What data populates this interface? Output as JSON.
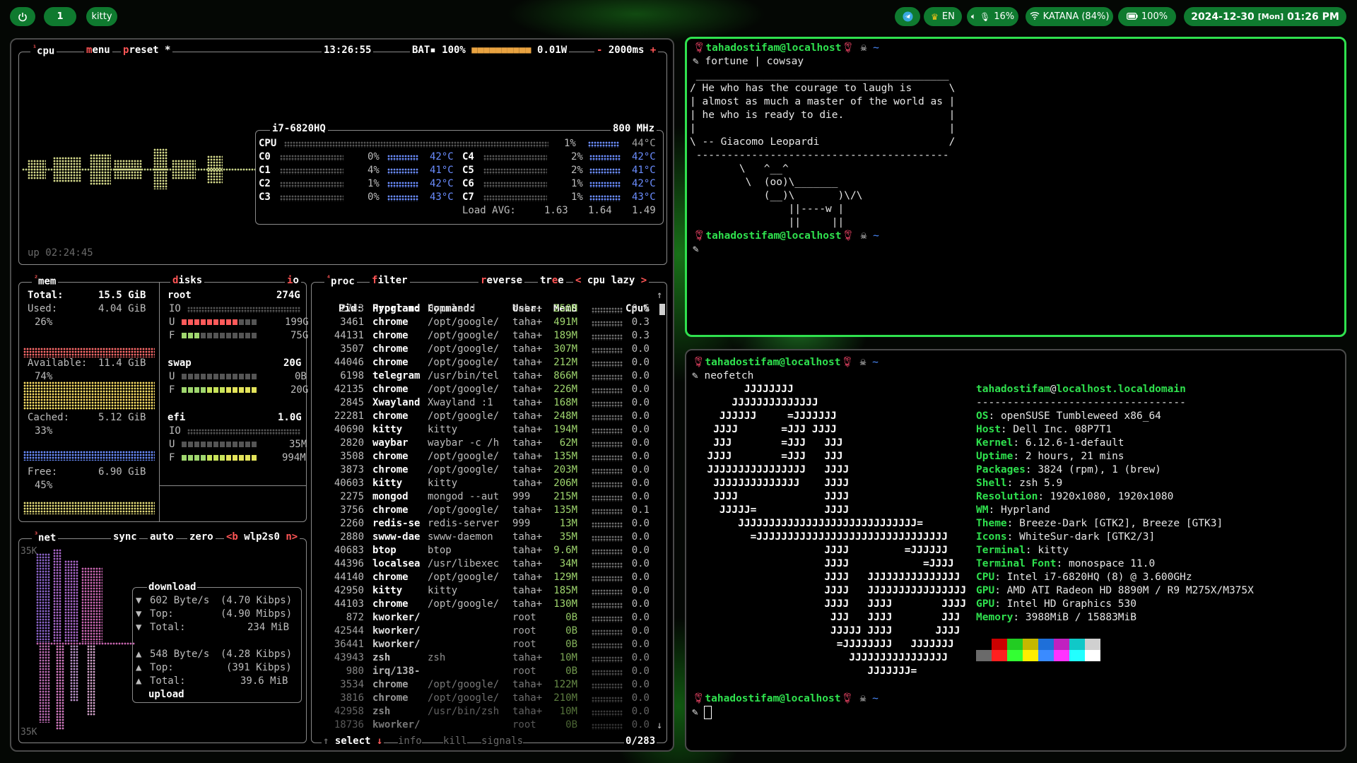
{
  "topbar": {
    "power_icon": "power-icon",
    "workspace": "1",
    "active_app": "kitty",
    "telegram_icon": "telegram-icon",
    "keyboard_layout": "EN",
    "volume": "16%",
    "wifi": "KATANA (84%)",
    "battery": "100%",
    "date": "2024-12-30",
    "weekday": "[Mon]",
    "time": "01:26 PM",
    "accent": "#0f7a2f"
  },
  "btop": {
    "cpu": {
      "tab": "cpu",
      "menu": "menu",
      "preset": "preset *",
      "clock": "13:26:55",
      "battery": "BAT▪ 100%",
      "power": "0.01W",
      "interval": "2000ms",
      "model": "i7-6820HQ",
      "freq": "800 MHz",
      "total": {
        "label": "CPU",
        "pct": "1%",
        "temp": "44°C"
      },
      "cores": [
        {
          "name": "C0",
          "pct": "0%",
          "temp": "42°C"
        },
        {
          "name": "C1",
          "pct": "4%",
          "temp": "41°C"
        },
        {
          "name": "C2",
          "pct": "1%",
          "temp": "42°C"
        },
        {
          "name": "C3",
          "pct": "0%",
          "temp": "43°C"
        },
        {
          "name": "C4",
          "pct": "2%",
          "temp": "42°C"
        },
        {
          "name": "C5",
          "pct": "2%",
          "temp": "41°C"
        },
        {
          "name": "C6",
          "pct": "1%",
          "temp": "42°C"
        },
        {
          "name": "C7",
          "pct": "1%",
          "temp": "43°C"
        }
      ],
      "load_label": "Load AVG:",
      "load": [
        "1.63",
        "1.64",
        "1.49"
      ],
      "uptime": "up 02:24:45"
    },
    "mem": {
      "tab": "mem",
      "total_label": "Total:",
      "total": "15.5 GiB",
      "used_label": "Used:",
      "used": "4.04 GiB",
      "used_pct": "26%",
      "avail_label": "Available:",
      "avail": "11.4 GiB",
      "avail_pct": "74%",
      "cached_label": "Cached:",
      "cached": "5.12 GiB",
      "cached_pct": "33%",
      "free_label": "Free:",
      "free": "6.90 GiB",
      "free_pct": "45%"
    },
    "disks": {
      "tab": "disks",
      "io_tab": "io",
      "items": [
        {
          "name": "root",
          "size": "274G",
          "io": "IO",
          "u_label": "U",
          "used": "199G",
          "f_label": "F",
          "free": "75G"
        },
        {
          "name": "swap",
          "size": "20G",
          "io": "",
          "u_label": "U",
          "used": "0B",
          "f_label": "F",
          "free": "20G"
        },
        {
          "name": "efi",
          "size": "1.0G",
          "io": "IO",
          "u_label": "U",
          "used": "35M",
          "f_label": "F",
          "free": "994M"
        }
      ]
    },
    "net": {
      "tab": "net",
      "sync": "sync",
      "auto": "auto",
      "zero": "zero",
      "prev": "<b",
      "iface": "wlp2s0",
      "next": "n>",
      "scale_top": "35K",
      "scale_bottom": "35K",
      "download_label": "download",
      "dl_rate": "602 Byte/s",
      "dl_rate_bits": "(4.70 Kibps)",
      "dl_top_label": "Top:",
      "dl_top": "(4.90 Mibps)",
      "dl_total_label": "Total:",
      "dl_total": "234 MiB",
      "ul_rate": "548 Byte/s",
      "ul_rate_bits": "(4.28 Kibps)",
      "ul_top_label": "Top:",
      "ul_top": "(391 Kibps)",
      "ul_total_label": "Total:",
      "ul_total": "39.6 MiB",
      "upload_label": "upload"
    },
    "proc": {
      "tab": "proc",
      "filter": "filter",
      "reverse": "reverse",
      "tree": "tree",
      "sort": "cpu lazy",
      "columns": [
        "Pid:",
        "Program:",
        "Command:",
        "User:",
        "MemB",
        "Cpu%"
      ],
      "rows": [
        [
          "2743",
          "Hyprland",
          "Hyprland",
          "taha+",
          "250M",
          "0.6"
        ],
        [
          "3461",
          "chrome",
          "/opt/google/",
          "taha+",
          "491M",
          "0.3"
        ],
        [
          "44131",
          "chrome",
          "/opt/google/",
          "taha+",
          "189M",
          "0.3"
        ],
        [
          "3507",
          "chrome",
          "/opt/google/",
          "taha+",
          "307M",
          "0.0"
        ],
        [
          "44046",
          "chrome",
          "/opt/google/",
          "taha+",
          "212M",
          "0.0"
        ],
        [
          "6198",
          "telegram",
          "/usr/bin/tel",
          "taha+",
          "866M",
          "0.0"
        ],
        [
          "42135",
          "chrome",
          "/opt/google/",
          "taha+",
          "226M",
          "0.0"
        ],
        [
          "2845",
          "Xwayland",
          "Xwayland :1",
          "taha+",
          "168M",
          "0.0"
        ],
        [
          "22281",
          "chrome",
          "/opt/google/",
          "taha+",
          "248M",
          "0.0"
        ],
        [
          "40690",
          "kitty",
          "kitty",
          "taha+",
          "194M",
          "0.0"
        ],
        [
          "2820",
          "waybar",
          "waybar -c /h",
          "taha+",
          "62M",
          "0.0"
        ],
        [
          "3508",
          "chrome",
          "/opt/google/",
          "taha+",
          "135M",
          "0.0"
        ],
        [
          "3873",
          "chrome",
          "/opt/google/",
          "taha+",
          "203M",
          "0.0"
        ],
        [
          "40603",
          "kitty",
          "kitty",
          "taha+",
          "206M",
          "0.0"
        ],
        [
          "2275",
          "mongod",
          "mongod --aut",
          "999",
          "215M",
          "0.0"
        ],
        [
          "3756",
          "chrome",
          "/opt/google/",
          "taha+",
          "135M",
          "0.1"
        ],
        [
          "2260",
          "redis-se",
          "redis-server",
          "999",
          "13M",
          "0.0"
        ],
        [
          "2880",
          "swww-dae",
          "swww-daemon",
          "taha+",
          "35M",
          "0.0"
        ],
        [
          "40683",
          "btop",
          "btop",
          "taha+",
          "9.6M",
          "0.0"
        ],
        [
          "44396",
          "localsea",
          "/usr/libexec",
          "taha+",
          "34M",
          "0.0"
        ],
        [
          "44140",
          "chrome",
          "/opt/google/",
          "taha+",
          "129M",
          "0.0"
        ],
        [
          "42950",
          "kitty",
          "kitty",
          "taha+",
          "185M",
          "0.0"
        ],
        [
          "44103",
          "chrome",
          "/opt/google/",
          "taha+",
          "130M",
          "0.0"
        ],
        [
          "872",
          "kworker/",
          "",
          "root",
          "0B",
          "0.0"
        ],
        [
          "42544",
          "kworker/",
          "",
          "root",
          "0B",
          "0.0"
        ],
        [
          "36441",
          "kworker/",
          "",
          "root",
          "0B",
          "0.0"
        ],
        [
          "43943",
          "zsh",
          "zsh",
          "taha+",
          "10M",
          "0.0"
        ],
        [
          "980",
          "irq/138-",
          "",
          "root",
          "0B",
          "0.0"
        ],
        [
          "3534",
          "chrome",
          "/opt/google/",
          "taha+",
          "122M",
          "0.0"
        ],
        [
          "3816",
          "chrome",
          "/opt/google/",
          "taha+",
          "210M",
          "0.0"
        ],
        [
          "42958",
          "zsh",
          "/usr/bin/zsh",
          "taha+",
          "10M",
          "0.0"
        ],
        [
          "18736",
          "kworker/",
          "",
          "root",
          "0B",
          "0.0"
        ]
      ],
      "footer_select": "select",
      "footer_info": "info",
      "footer_kill": "kill",
      "footer_signals": "signals",
      "footer_count": "0/283"
    }
  },
  "terminal_top": {
    "user": "tahadostifam@localhost",
    "tilde": "~",
    "command": "fortune | cowsay",
    "cowsay": " _________________________________________\n/ He who has the courage to laugh is      \\\n| almost as much a master of the world as |\n| he who is ready to die.                 |\n|                                         |\n\\ -- Giacomo Leopardi                     /\n -----------------------------------------\n        \\   ^__^\n         \\  (oo)\\_______\n            (__)\\       )\\/\\\n                ||----w |\n                ||     ||",
    "user2": "tahadostifam@localhost",
    "tilde2": "~"
  },
  "terminal_bottom": {
    "user": "tahadostifam@localhost",
    "tilde": "~",
    "command": "neofetch",
    "logo": "        JJJJJJJJ\n      JJJJJJJJJJJJJJ\n    JJJJJJ     =JJJJJJJ\n   JJJJ       =JJJ JJJJ\n   JJJ        =JJJ   JJJ\n  JJJJ        =JJJ   JJJ\n  JJJJJJJJJJJJJJJJ   JJJJ\n   JJJJJJJJJJJJJJ    JJJJ\n   JJJJ              JJJJ\n    JJJJJ=           JJJJ\n       JJJJJJJJJJJJJJJJJJJJJJJJJJJJJ=\n         =JJJJJJJJJJJJJJJJJJJJJJJJJJJJJJJ\n                     JJJJ         =JJJJJJ\n                     JJJJ            =JJJJ\n                     JJJJ   JJJJJJJJJJJJJJJ\n                     JJJJ   JJJJJJJJJJJJJJJJ\n                     JJJJ   JJJJ        JJJJ\n                      JJJ   JJJJ        JJJ\n                      JJJJJ JJJJ       JJJJ\n                       =JJJJJJJJ   JJJJJJJ\n                         JJJJJJJJJJJJJJJJ\n                            JJJJJJJ=",
    "host_user": "tahadostifam",
    "host_domain": "localhost.localdomain",
    "separator": "----------------------------------",
    "info": [
      {
        "key": "OS",
        "value": "openSUSE Tumbleweed x86_64"
      },
      {
        "key": "Host",
        "value": "Dell Inc. 08P7T1"
      },
      {
        "key": "Kernel",
        "value": "6.12.6-1-default"
      },
      {
        "key": "Uptime",
        "value": "2 hours, 21 mins"
      },
      {
        "key": "Packages",
        "value": "3824 (rpm), 1 (brew)"
      },
      {
        "key": "Shell",
        "value": "zsh 5.9"
      },
      {
        "key": "Resolution",
        "value": "1920x1080, 1920x1080"
      },
      {
        "key": "WM",
        "value": "Hyprland"
      },
      {
        "key": "Theme",
        "value": "Breeze-Dark [GTK2], Breeze [GTK3]"
      },
      {
        "key": "Icons",
        "value": "WhiteSur-dark [GTK2/3]"
      },
      {
        "key": "Terminal",
        "value": "kitty"
      },
      {
        "key": "Terminal Font",
        "value": "monospace 11.0"
      },
      {
        "key": "CPU",
        "value": "Intel i7-6820HQ (8) @ 3.600GHz"
      },
      {
        "key": "GPU",
        "value": "AMD ATI Radeon HD 8890M / R9 M275X/M375X"
      },
      {
        "key": "GPU",
        "value": "Intel HD Graphics 530"
      },
      {
        "key": "Memory",
        "value": "3988MiB / 15883MiB"
      }
    ],
    "palette_top": [
      "#000000",
      "#cc0000",
      "#22cc22",
      "#c4b800",
      "#1e6fd9",
      "#c020c0",
      "#10c8c8",
      "#d0d0d0"
    ],
    "palette_bottom": [
      "#6a6a6a",
      "#ff2020",
      "#33ff33",
      "#ffee00",
      "#3a8bff",
      "#ff33ff",
      "#22ffff",
      "#ffffff"
    ],
    "user2": "tahadostifam@localhost",
    "tilde2": "~"
  }
}
